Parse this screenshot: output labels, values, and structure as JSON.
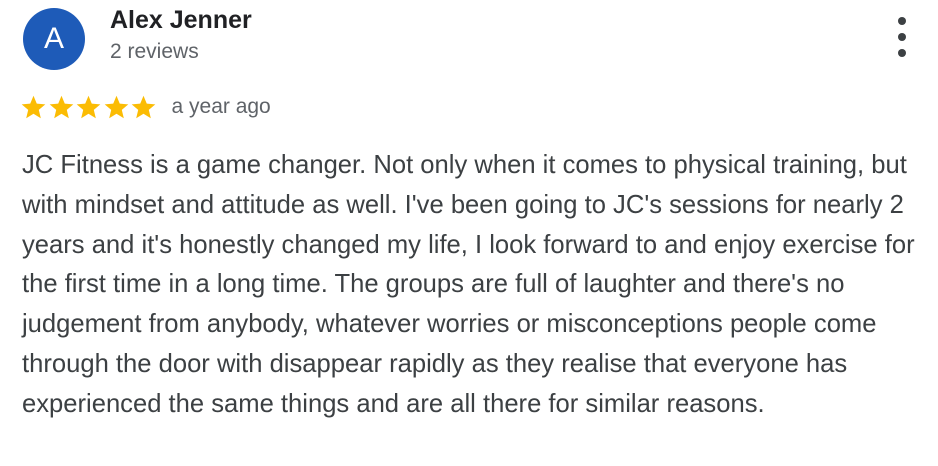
{
  "reviewer": {
    "initial": "A",
    "name": "Alex Jenner",
    "review_count": "2 reviews",
    "avatar_color": "#1e5bb8"
  },
  "menu": {
    "icon": "more-vert-icon"
  },
  "rating": {
    "stars": 5,
    "max": 5,
    "star_color": "#fbbc04",
    "timestamp": "a year ago"
  },
  "review": {
    "text": "JC Fitness is a game changer. Not only when it comes to physical training, but with mindset and attitude as well. I've been going to JC's sessions for nearly 2 years and it's honestly changed my life, I look forward to and enjoy exercise for the first time in a long time. The groups are full of laughter and there's no judgement from anybody, whatever worries or misconceptions people come through the door with disappear rapidly as they realise that everyone has experienced the same things and are all there for similar reasons."
  }
}
